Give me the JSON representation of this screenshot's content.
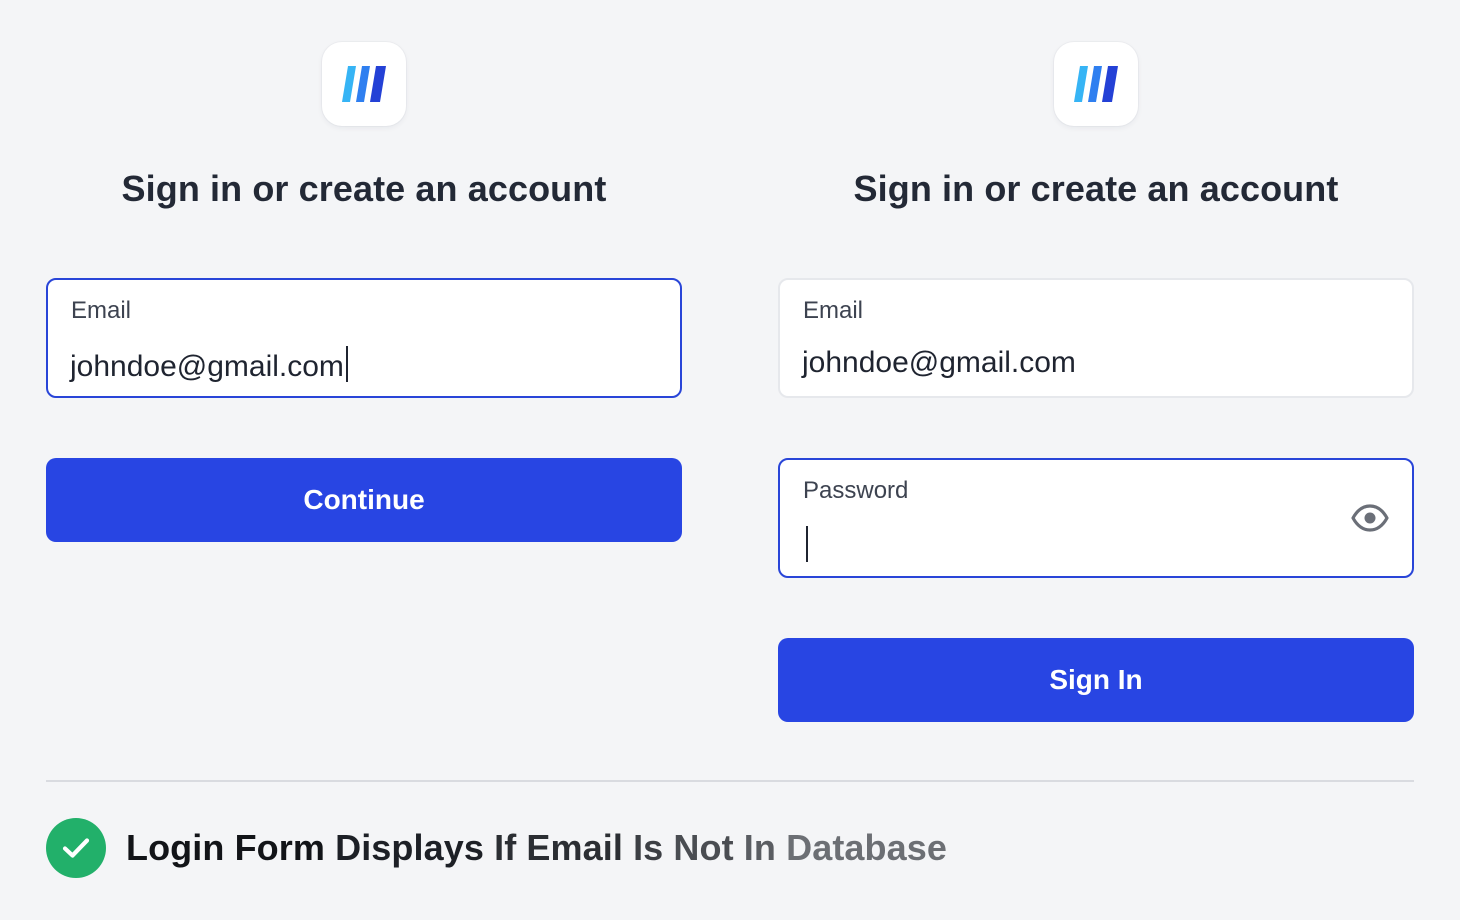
{
  "colors": {
    "accent": "#2845e3",
    "focus_border": "#2945d8",
    "success": "#22b06a",
    "background": "#f4f5f7"
  },
  "left_panel": {
    "logo": "brand-stripes-logo",
    "heading": "Sign in or create an account",
    "email": {
      "label": "Email",
      "value": "johndoe@gmail.com",
      "focused": true
    },
    "continue_label": "Continue"
  },
  "right_panel": {
    "logo": "brand-stripes-logo",
    "heading": "Sign in or create an account",
    "email": {
      "label": "Email",
      "value": "johndoe@gmail.com",
      "focused": false
    },
    "password": {
      "label": "Password",
      "value": "",
      "focused": true,
      "toggle_icon": "eye-icon"
    },
    "signin_label": "Sign In"
  },
  "status": {
    "icon": "check-circle-icon",
    "words": [
      "Login",
      "Form",
      "Displays",
      "If",
      "Email",
      "Is",
      "Not",
      "In",
      "Database"
    ]
  }
}
